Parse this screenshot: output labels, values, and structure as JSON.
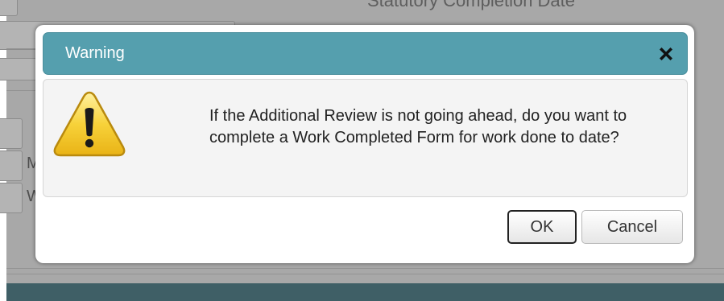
{
  "background": {
    "heading": "Statutory Completion Date",
    "letters": [
      "M",
      "W"
    ]
  },
  "dialog": {
    "title": "Warning",
    "close_icon": "close-icon",
    "warning_icon": "warning-triangle-icon",
    "message": "If the Additional Review is not going ahead, do you want to complete a Work Completed Form for work done to date?",
    "ok_label": "OK",
    "cancel_label": "Cancel"
  },
  "colors": {
    "titlebar": "#559fae",
    "overlay": "#a8a8a8",
    "footer": "#3f5f66"
  }
}
